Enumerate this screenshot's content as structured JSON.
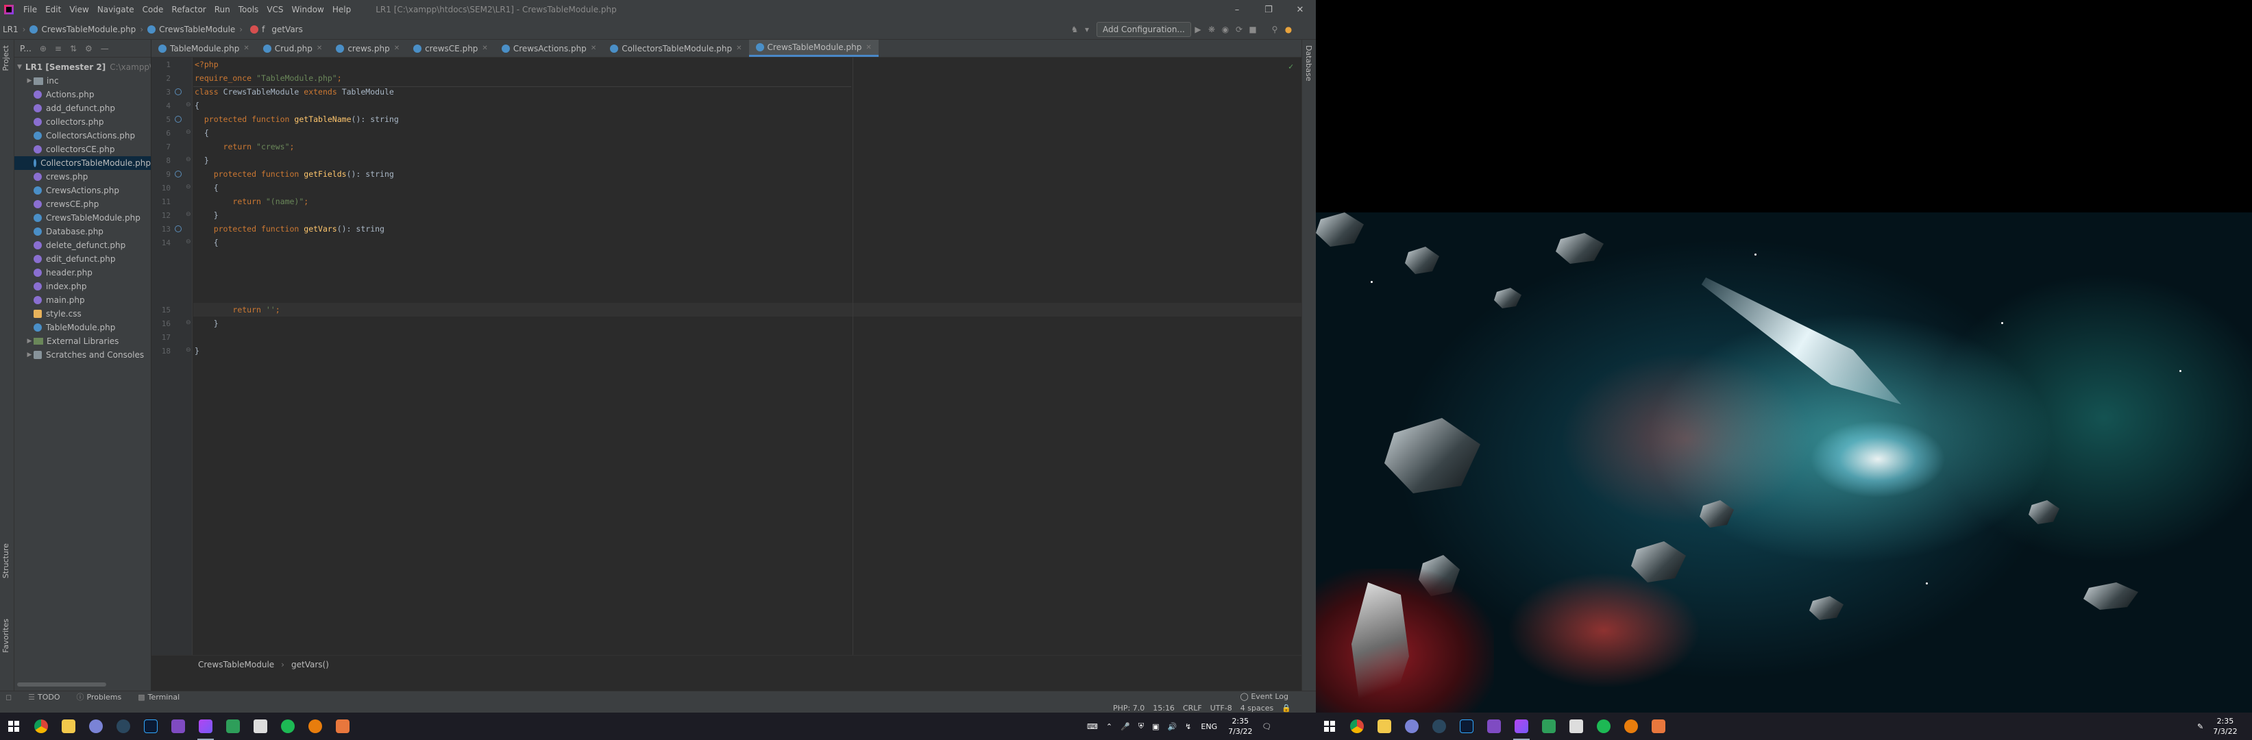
{
  "ide": {
    "menu": [
      "File",
      "Edit",
      "View",
      "Navigate",
      "Code",
      "Refactor",
      "Run",
      "Tools",
      "VCS",
      "Window",
      "Help"
    ],
    "window_title": "LR1 [C:\\xampp\\htdocs\\SEM2\\LR1] - CrewsTableModule.php",
    "nav": {
      "project": "LR1",
      "file": "CrewsTableModule.php",
      "class": "CrewsTableModule",
      "method_prefix": "f",
      "method": "getVars"
    },
    "add_configuration": "Add Configuration...",
    "project_panel": {
      "title": "P...",
      "root": "LR1 [Semester 2]",
      "root_path": "C:\\xampp\\",
      "items": [
        {
          "name": "inc",
          "type": "folder"
        },
        {
          "name": "Actions.php",
          "type": "php"
        },
        {
          "name": "add_defunct.php",
          "type": "php"
        },
        {
          "name": "collectors.php",
          "type": "php"
        },
        {
          "name": "CollectorsActions.php",
          "type": "phpc"
        },
        {
          "name": "collectorsCE.php",
          "type": "php"
        },
        {
          "name": "CollectorsTableModule.php",
          "type": "phpc"
        },
        {
          "name": "crews.php",
          "type": "php"
        },
        {
          "name": "CrewsActions.php",
          "type": "phpc"
        },
        {
          "name": "crewsCE.php",
          "type": "php"
        },
        {
          "name": "CrewsTableModule.php",
          "type": "phpc"
        },
        {
          "name": "Database.php",
          "type": "phpc"
        },
        {
          "name": "delete_defunct.php",
          "type": "php"
        },
        {
          "name": "edit_defunct.php",
          "type": "php"
        },
        {
          "name": "header.php",
          "type": "php"
        },
        {
          "name": "index.php",
          "type": "php"
        },
        {
          "name": "main.php",
          "type": "php"
        },
        {
          "name": "style.css",
          "type": "css"
        },
        {
          "name": "TableModule.php",
          "type": "phpc"
        }
      ],
      "external": "External Libraries",
      "scratches": "Scratches and Consoles"
    },
    "tabs": [
      "TableModule.php",
      "Crud.php",
      "crews.php",
      "crewsCE.php",
      "CrewsActions.php",
      "CollectorsTableModule.php",
      "CrewsTableModule.php"
    ],
    "code_lines": [
      "1",
      "2",
      "3",
      "4",
      "5",
      "6",
      "7",
      "8",
      "9",
      "10",
      "11",
      "12",
      "13",
      "14",
      "15",
      "16",
      "17",
      "18"
    ],
    "breadcrumb": {
      "class": "CrewsTableModule",
      "method": "getVars()"
    },
    "left_strip": {
      "project": "Project",
      "structure": "Structure",
      "favorites": "Favorites"
    },
    "right_strip": {
      "database": "Database"
    },
    "bottom_tabs": [
      "TODO",
      "Problems",
      "Terminal"
    ],
    "event_log": "Event Log",
    "status": {
      "php": "PHP: 7.0",
      "pos": "15:16",
      "eol": "CRLF",
      "enc": "UTF-8",
      "indent": "4 spaces"
    }
  },
  "taskbar": {
    "left_time": "2:35",
    "left_date": "7/3/22",
    "lang": "ENG",
    "right_time": "2:35",
    "right_date": "7/3/22"
  },
  "colors": {
    "accent": "#4a88c7",
    "ide_bg": "#2b2b2b",
    "panel_bg": "#3c3f41"
  }
}
